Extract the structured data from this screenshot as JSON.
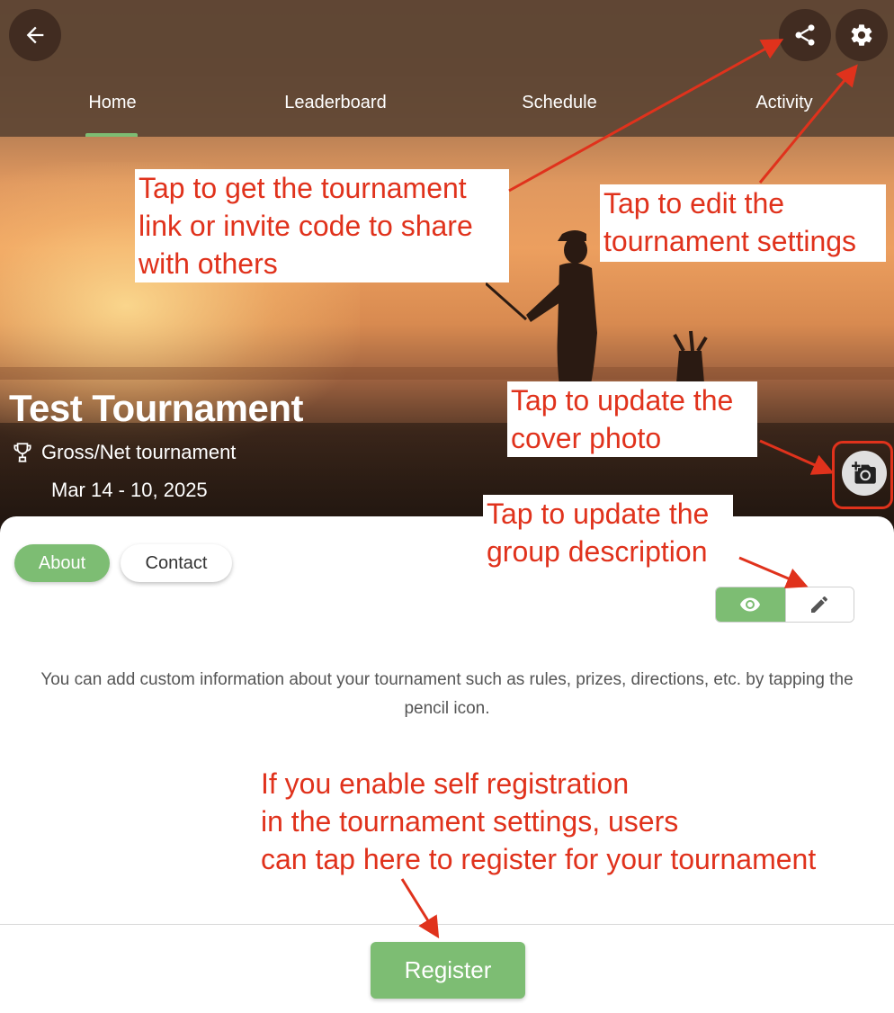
{
  "header": {
    "tabs": [
      {
        "label": "Home",
        "active": true
      },
      {
        "label": "Leaderboard",
        "active": false
      },
      {
        "label": "Schedule",
        "active": false
      },
      {
        "label": "Activity",
        "active": false
      }
    ],
    "icons": {
      "back": "arrow-left-icon",
      "share": "share-icon",
      "settings": "gear-icon"
    }
  },
  "tournament": {
    "title": "Test Tournament",
    "type": "Gross/Net tournament",
    "type_icon": "trophy-icon",
    "dates": "Mar 14 - 10, 2025",
    "cover_icon": "add-photo-camera-icon"
  },
  "content": {
    "pills": [
      {
        "label": "About",
        "active": true
      },
      {
        "label": "Contact",
        "active": false
      }
    ],
    "toggle": {
      "view_icon": "eye-icon",
      "edit_icon": "pencil-icon",
      "selected": "view"
    },
    "description": "You can add custom information about your tournament such as rules, prizes, directions, etc. by tapping the pencil icon.",
    "register_label": "Register"
  },
  "annotations": {
    "share": [
      "Tap to get the tournament",
      "link or invite code to share",
      "with others"
    ],
    "settings": [
      "Tap to edit the",
      "tournament settings"
    ],
    "cover": [
      "Tap to update the",
      "cover photo"
    ],
    "description": [
      "Tap to update the",
      "group description"
    ],
    "register": [
      "If you enable self registration",
      "in the tournament settings, users",
      "can tap here to register for your tournament"
    ]
  },
  "colors": {
    "accent_green": "#7dbd73",
    "annotation_red": "#e0321c",
    "topbar_brown": "#5f4634"
  }
}
